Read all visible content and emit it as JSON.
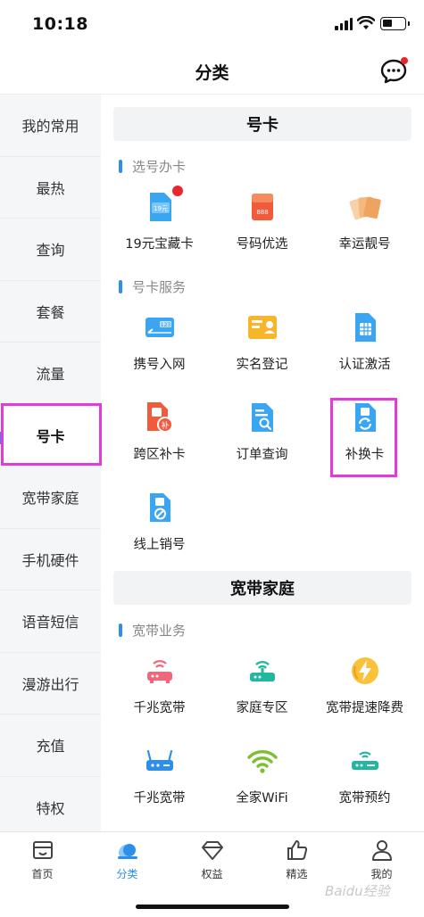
{
  "status_bar": {
    "time": "10:18"
  },
  "nav": {
    "title": "分类"
  },
  "sidebar": {
    "items": [
      {
        "label": "我的常用"
      },
      {
        "label": "最热"
      },
      {
        "label": "查询"
      },
      {
        "label": "套餐"
      },
      {
        "label": "流量"
      },
      {
        "label": "号卡",
        "active": true
      },
      {
        "label": "宽带家庭"
      },
      {
        "label": "手机硬件"
      },
      {
        "label": "语音短信"
      },
      {
        "label": "漫游出行"
      },
      {
        "label": "充值"
      },
      {
        "label": "特权"
      }
    ]
  },
  "sections": [
    {
      "title": "号卡",
      "groups": [
        {
          "title": "选号办卡",
          "items": [
            {
              "label": "19元宝藏卡",
              "icon": "sim-19-icon",
              "badge_text": "19元"
            },
            {
              "label": "号码优选",
              "icon": "red-card-icon",
              "badge_text": "888"
            },
            {
              "label": "幸运靓号",
              "icon": "lucky-cards-icon"
            }
          ]
        },
        {
          "title": "号卡服务",
          "items": [
            {
              "label": "携号入网",
              "icon": "transfer-card-icon",
              "badge_text": "123"
            },
            {
              "label": "实名登记",
              "icon": "id-card-icon"
            },
            {
              "label": "认证激活",
              "icon": "sim-chip-icon"
            },
            {
              "label": "跨区补卡",
              "icon": "sim-reissue-icon",
              "badge_text": "补"
            },
            {
              "label": "订单查询",
              "icon": "order-search-icon"
            },
            {
              "label": "补换卡",
              "icon": "sim-replace-icon"
            },
            {
              "label": "线上销号",
              "icon": "sim-cancel-icon"
            }
          ]
        }
      ]
    },
    {
      "title": "宽带家庭",
      "groups": [
        {
          "title": "宽带业务",
          "items": [
            {
              "label": "千兆宽带",
              "icon": "router-red-icon"
            },
            {
              "label": "家庭专区",
              "icon": "router-green-icon"
            },
            {
              "label": "宽带提速降费",
              "icon": "lightning-icon"
            },
            {
              "label": "千兆宽带",
              "icon": "router-blue-icon"
            },
            {
              "label": "全家WiFi",
              "icon": "wifi-icon"
            },
            {
              "label": "宽带预约",
              "icon": "router-teal-icon"
            }
          ]
        }
      ]
    }
  ],
  "tabs": [
    {
      "label": "首页",
      "icon": "home-icon"
    },
    {
      "label": "分类",
      "icon": "category-icon",
      "active": true
    },
    {
      "label": "权益",
      "icon": "diamond-icon"
    },
    {
      "label": "精选",
      "icon": "thumbs-up-icon"
    },
    {
      "label": "我的",
      "icon": "user-icon"
    }
  ],
  "watermark": "Baidu经验",
  "colors": {
    "accent": "#2e8fe8",
    "highlight": "#e43ad8",
    "badge_red": "#e8262f"
  }
}
